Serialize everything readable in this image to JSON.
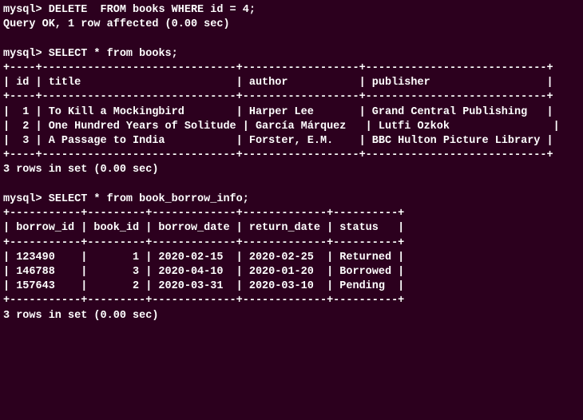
{
  "prompt": "mysql> ",
  "commands": {
    "delete": "DELETE  FROM books WHERE id = 4;",
    "select_books": "SELECT * from books;",
    "select_borrow": "SELECT * from book_borrow_info;"
  },
  "delete_result": "Query OK, 1 row affected (0.00 sec)",
  "books_table": {
    "sep_long": "+----+------------------------------+------------------+----------------------------+",
    "header": "| id | title                        | author           | publisher                  |",
    "rows": [
      "|  1 | To Kill a Mockingbird        | Harper Lee       | Grand Central Publishing   |",
      "|  2 | One Hundred Years of Solitude | García Márquez   | Lutfi Ozkok                |",
      "|  3 | A Passage to India           | Forster, E.M.    | BBC Hulton Picture Library |"
    ],
    "footer": "3 rows in set (0.00 sec)"
  },
  "borrow_table": {
    "sep": "+-----------+---------+-------------+-------------+----------+",
    "header": "| borrow_id | book_id | borrow_date | return_date | status   |",
    "rows": [
      "| 123490    |       1 | 2020-02-15  | 2020-02-25  | Returned |",
      "| 146788    |       3 | 2020-04-10  | 2020-01-20  | Borrowed |",
      "| 157643    |       2 | 2020-03-31  | 2020-03-10  | Pending  |"
    ],
    "footer": "3 rows in set (0.00 sec)"
  },
  "chart_data": {
    "type": "table",
    "tables": [
      {
        "name": "books",
        "columns": [
          "id",
          "title",
          "author",
          "publisher"
        ],
        "rows": [
          [
            1,
            "To Kill a Mockingbird",
            "Harper Lee",
            "Grand Central Publishing"
          ],
          [
            2,
            "One Hundred Years of Solitude",
            "García Márquez",
            "Lutfi Ozkok"
          ],
          [
            3,
            "A Passage to India",
            "Forster, E.M.",
            "BBC Hulton Picture Library"
          ]
        ]
      },
      {
        "name": "book_borrow_info",
        "columns": [
          "borrow_id",
          "book_id",
          "borrow_date",
          "return_date",
          "status"
        ],
        "rows": [
          [
            123490,
            1,
            "2020-02-15",
            "2020-02-25",
            "Returned"
          ],
          [
            146788,
            3,
            "2020-04-10",
            "2020-01-20",
            "Borrowed"
          ],
          [
            157643,
            2,
            "2020-03-31",
            "2020-03-10",
            "Pending"
          ]
        ]
      }
    ]
  }
}
